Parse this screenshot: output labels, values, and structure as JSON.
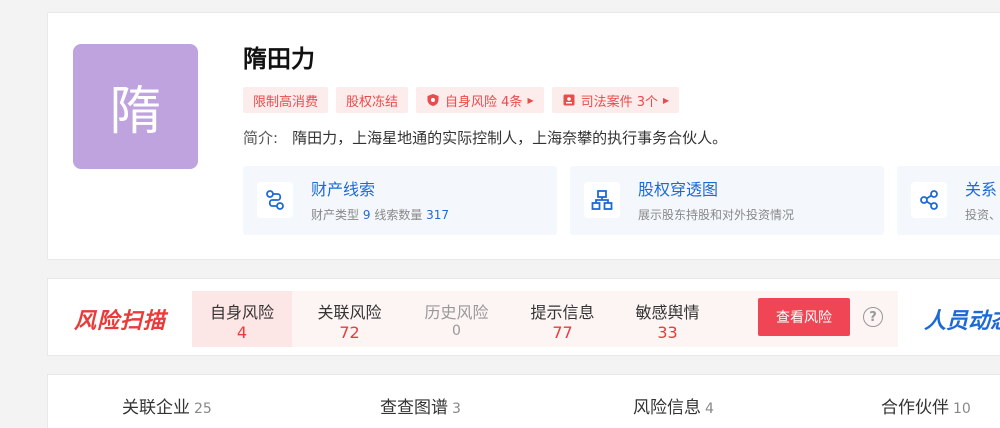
{
  "profile": {
    "avatar_char": "隋",
    "name": "隋田力",
    "tags": [
      {
        "label": "限制高消费"
      },
      {
        "label": "股权冻结"
      },
      {
        "label": "自身风险 4条",
        "icon": "shield-icon"
      },
      {
        "label": "司法案件 3个",
        "icon": "case-icon"
      }
    ],
    "intro_label": "简介:",
    "intro_text": "隋田力，上海星地通的实际控制人，上海奈攀的执行事务合伙人。"
  },
  "features": [
    {
      "title": "财产线索",
      "sub_prefix": "财产类型",
      "v1": "9",
      "sub_mid": "线索数量",
      "v2": "317",
      "icon": "property-clue-icon"
    },
    {
      "title": "股权穿透图",
      "sub": "展示股东持股和对外投资情况",
      "icon": "equity-chart-icon"
    },
    {
      "title": "关系",
      "sub": "投资、",
      "icon": "share-relation-icon"
    }
  ],
  "risk": {
    "logo": "风险扫描",
    "items": [
      {
        "label": "自身风险",
        "value": "4"
      },
      {
        "label": "关联风险",
        "value": "72"
      },
      {
        "label": "历史风险",
        "value": "0"
      },
      {
        "label": "提示信息",
        "value": "77"
      },
      {
        "label": "敏感舆情",
        "value": "33"
      }
    ],
    "button": "查看风险",
    "help": "?",
    "people_logo": "人员动态"
  },
  "tabs": [
    {
      "label": "关联企业",
      "count": "25"
    },
    {
      "label": "查查图谱",
      "count": "3"
    },
    {
      "label": "风险信息",
      "count": "4"
    },
    {
      "label": "合作伙伴",
      "count": "10"
    }
  ],
  "colors": {
    "accent_red": "#ea3b3b",
    "accent_blue": "#1d6ad6",
    "avatar_bg": "#bfa3df"
  }
}
